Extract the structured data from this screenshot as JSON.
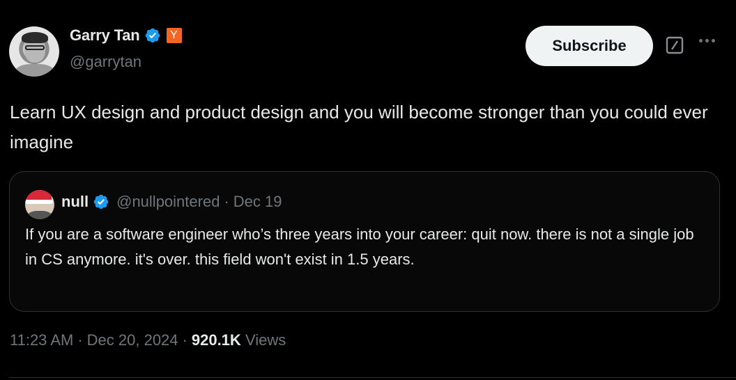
{
  "author": {
    "name": "Garry Tan",
    "handle": "@garrytan",
    "verified": true,
    "affiliate_badge": "Y",
    "affiliate_color": "#f26522"
  },
  "actions": {
    "subscribe_label": "Subscribe",
    "grok_icon": "grok-slash-icon",
    "more_icon": "more-horizontal-icon"
  },
  "tweet": {
    "text": "Learn UX design and product design and you will become stronger than you could ever imagine"
  },
  "quoted_tweet": {
    "name": "null",
    "handle": "@nullpointered",
    "separator": "·",
    "date": "Dec 19",
    "verified": true,
    "text": "If you are a software engineer who’s three years into your career: quit now. there is not a single job in CS anymore. it's over. this field won't exist in 1.5 years."
  },
  "meta": {
    "time": "11:23 AM",
    "sep1": "·",
    "date": "Dec 20, 2024",
    "sep2": "·",
    "views_count": "920.1K",
    "views_label": "Views"
  },
  "colors": {
    "background": "#000000",
    "text_primary": "#e7e9ea",
    "text_secondary": "#71767b",
    "verified_blue": "#1d9bf0",
    "border": "#2f3336"
  }
}
